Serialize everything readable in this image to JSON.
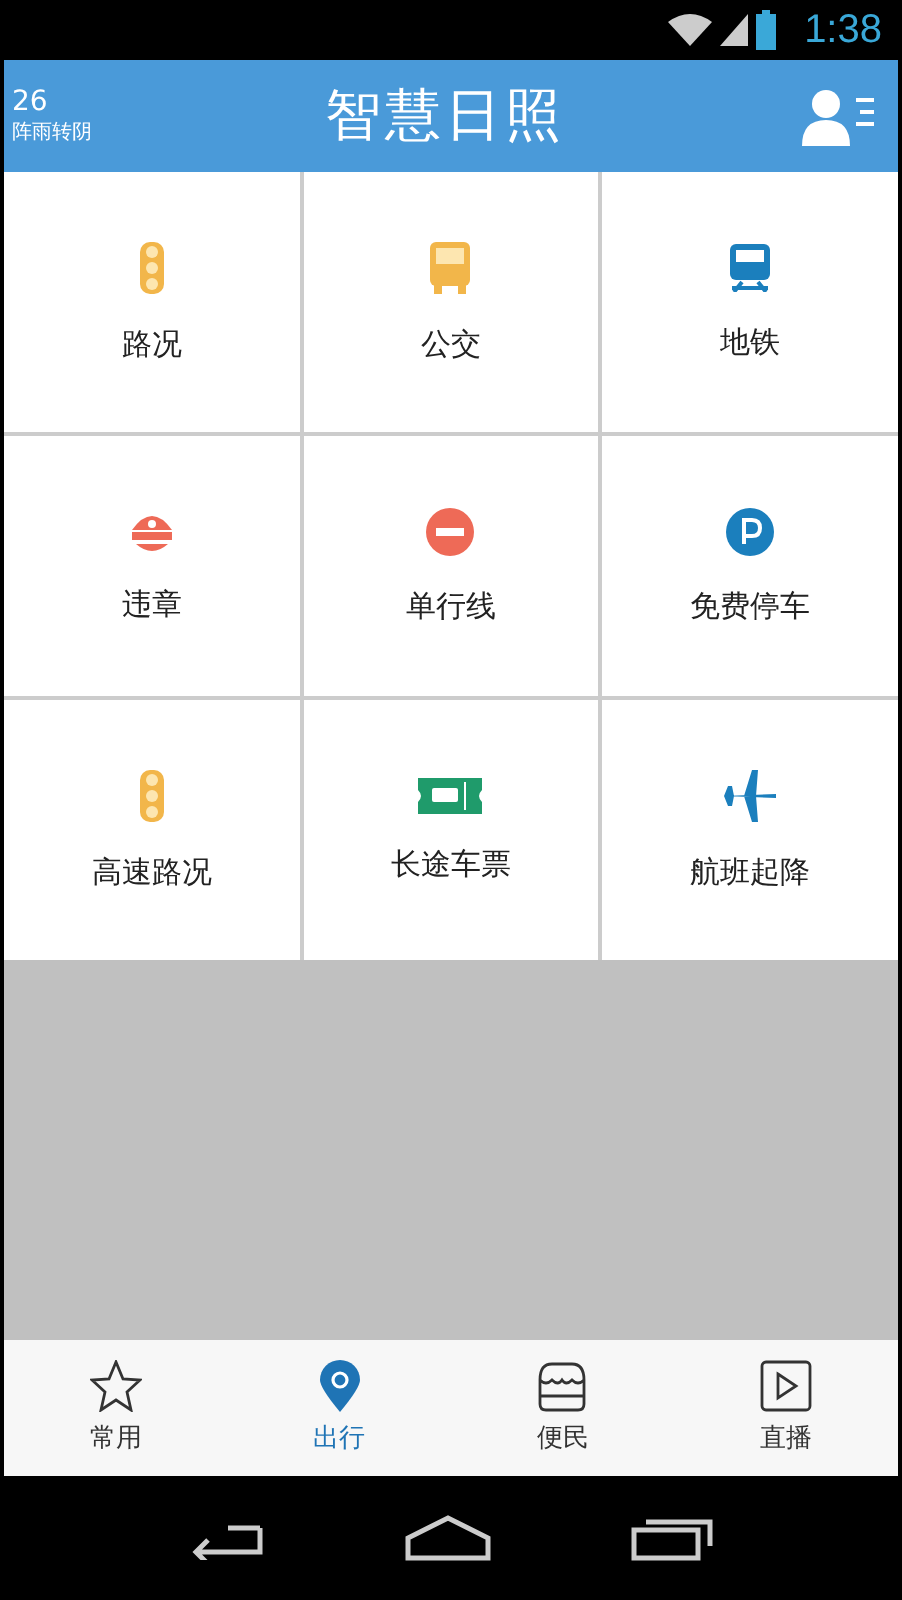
{
  "status_bar": {
    "time": "1:38"
  },
  "header": {
    "temperature": "26",
    "weather": "阵雨转阴",
    "title": "智慧日照"
  },
  "tiles": [
    {
      "label": "路况",
      "kind": "traffic-light"
    },
    {
      "label": "公交",
      "kind": "bus"
    },
    {
      "label": "地铁",
      "kind": "train"
    },
    {
      "label": "违章",
      "kind": "police-cap"
    },
    {
      "label": "单行线",
      "kind": "no-entry"
    },
    {
      "label": "免费停车",
      "kind": "parking"
    },
    {
      "label": "高速路况",
      "kind": "traffic-light"
    },
    {
      "label": "长途车票",
      "kind": "ticket"
    },
    {
      "label": "航班起降",
      "kind": "plane"
    }
  ],
  "tabs": [
    {
      "label": "常用",
      "kind": "star",
      "selected": false
    },
    {
      "label": "出行",
      "kind": "pin",
      "selected": true
    },
    {
      "label": "便民",
      "kind": "shop",
      "selected": false
    },
    {
      "label": "直播",
      "kind": "play",
      "selected": false
    }
  ]
}
